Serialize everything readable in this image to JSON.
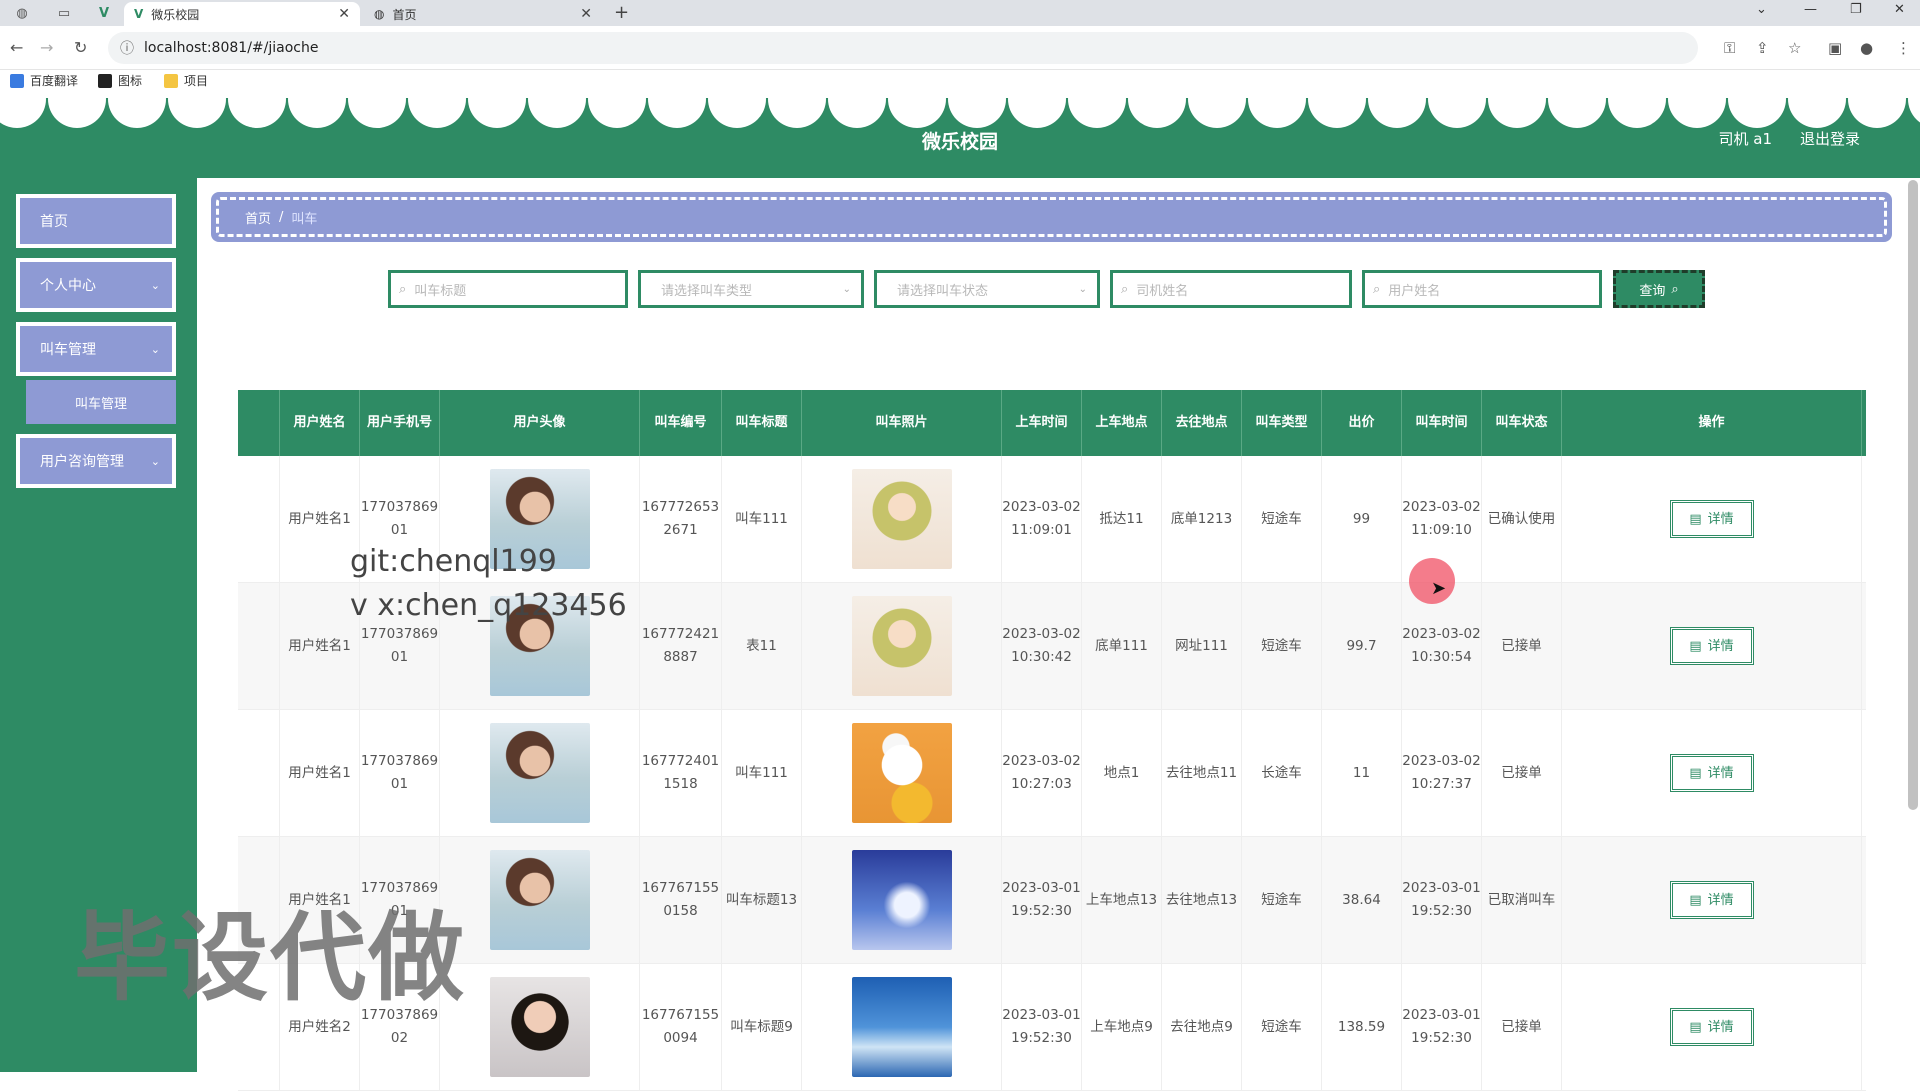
{
  "browser": {
    "tabs": [
      {
        "title": "微乐校园",
        "close": "✕"
      },
      {
        "title": "首页",
        "close": "✕"
      }
    ],
    "new_tab": "+",
    "url": "localhost:8081/#/jiaoche",
    "bookmarks": [
      "百度翻译",
      "图标",
      "项目"
    ]
  },
  "header": {
    "title": "微乐校园",
    "user": "司机 a1",
    "logout": "退出登录"
  },
  "sidebar": {
    "items": [
      {
        "label": "首页"
      },
      {
        "label": "个人中心"
      },
      {
        "label": "叫车管理"
      },
      {
        "label": "叫车管理"
      },
      {
        "label": "用户咨询管理"
      }
    ]
  },
  "breadcrumb": {
    "home": "首页",
    "sep": "/",
    "current": "叫车"
  },
  "search": {
    "title_placeholder": "叫车标题",
    "type_placeholder": "请选择叫车类型",
    "status_placeholder": "请选择叫车状态",
    "driver_placeholder": "司机姓名",
    "user_placeholder": "用户姓名",
    "query_label": "查询"
  },
  "table": {
    "headers": [
      "用户姓名",
      "用户手机号",
      "用户头像",
      "叫车编号",
      "叫车标题",
      "叫车照片",
      "上车时间",
      "上车地点",
      "去往地点",
      "叫车类型",
      "出价",
      "叫车时间",
      "叫车状态",
      "操作"
    ],
    "detail_label": "详情",
    "rows": [
      {
        "name": "用户姓名1",
        "phone": "17703786901",
        "avatar": "girl",
        "no": "1677726532671",
        "title": "叫车111",
        "photo": "anime",
        "pickup_time": "2023-03-02 11:09:01",
        "from": "抵达11",
        "to": "底单1213",
        "type": "短途车",
        "price": "99",
        "call_time": "2023-03-02 11:09:10",
        "status": "已确认使用"
      },
      {
        "name": "用户姓名1",
        "phone": "17703786901",
        "avatar": "girl",
        "no": "1677724218887",
        "title": "表11",
        "photo": "anime",
        "pickup_time": "2023-03-02 10:30:42",
        "from": "底单111",
        "to": "网址111",
        "type": "短途车",
        "price": "99.7",
        "call_time": "2023-03-02 10:30:54",
        "status": "已接单"
      },
      {
        "name": "用户姓名1",
        "phone": "17703786901",
        "avatar": "girl",
        "no": "1677724011518",
        "title": "叫车111",
        "photo": "cartoon",
        "pickup_time": "2023-03-02 10:27:03",
        "from": "地点1",
        "to": "去往地点11",
        "type": "长途车",
        "price": "11",
        "call_time": "2023-03-02 10:27:37",
        "status": "已接单"
      },
      {
        "name": "用户姓名1",
        "phone": "17703786901",
        "avatar": "girl",
        "no": "1677671550158",
        "title": "叫车标题13",
        "photo": "sky1",
        "pickup_time": "2023-03-01 19:52:30",
        "from": "上车地点13",
        "to": "去往地点13",
        "type": "短途车",
        "price": "38.64",
        "call_time": "2023-03-01 19:52:30",
        "status": "已取消叫车"
      },
      {
        "name": "用户姓名2",
        "phone": "17703786902",
        "avatar": "woman",
        "no": "1677671550094",
        "title": "叫车标题9",
        "photo": "sky2",
        "pickup_time": "2023-03-01 19:52:30",
        "from": "上车地点9",
        "to": "去往地点9",
        "type": "短途车",
        "price": "138.59",
        "call_time": "2023-03-01 19:52:30",
        "status": "已接单"
      }
    ]
  },
  "overlay": {
    "watermark1": "git:chenql199",
    "watermark2": "v x:chen_q123456",
    "stamp": "毕设代做"
  },
  "colors": {
    "primary": "#2e8b64",
    "menu": "#8e9ad4"
  }
}
